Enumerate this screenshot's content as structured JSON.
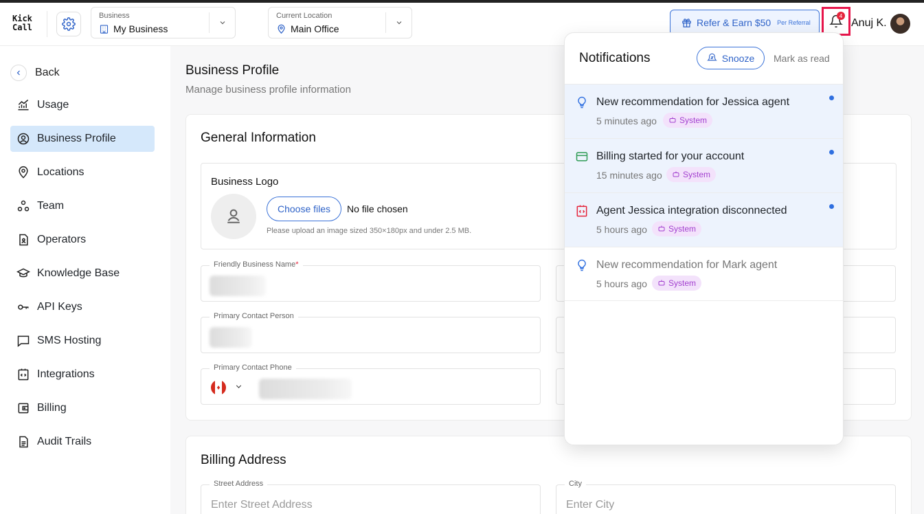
{
  "app": {
    "logo_line1": "Kick",
    "logo_line2": "Call"
  },
  "header": {
    "business_caption": "Business",
    "business_value": "My Business",
    "location_caption": "Current Location",
    "location_value": "Main Office",
    "refer_label": "Refer & Earn $50",
    "refer_sub": "Per Referral",
    "notification_count": "4",
    "user_name": "Anuj K."
  },
  "sidebar": {
    "back_label": "Back",
    "items": [
      {
        "label": "Usage",
        "icon": "chart-line-icon"
      },
      {
        "label": "Business Profile",
        "icon": "user-circle-icon",
        "active": true
      },
      {
        "label": "Locations",
        "icon": "map-pin-icon"
      },
      {
        "label": "Team",
        "icon": "team-icon"
      },
      {
        "label": "Operators",
        "icon": "operator-file-icon"
      },
      {
        "label": "Knowledge Base",
        "icon": "graduation-cap-icon"
      },
      {
        "label": "API Keys",
        "icon": "key-icon"
      },
      {
        "label": "SMS Hosting",
        "icon": "chat-bubble-icon"
      },
      {
        "label": "Integrations",
        "icon": "code-box-icon"
      },
      {
        "label": "Billing",
        "icon": "wallet-icon"
      },
      {
        "label": "Audit Trails",
        "icon": "document-icon"
      }
    ]
  },
  "main": {
    "title": "Business Profile",
    "subtitle": "Manage business profile information",
    "general": {
      "title": "General Information",
      "logo_label": "Business Logo",
      "choose_files": "Choose files",
      "no_file": "No file chosen",
      "hint": "Please upload an image sized 350×180px and under 2.5 MB.",
      "friendly_name_label": "Friendly Business Name",
      "required_mark": "*",
      "contact_person_label": "Primary Contact Person",
      "contact_phone_label": "Primary Contact Phone"
    },
    "billing": {
      "title": "Billing Address",
      "street_label": "Street Address",
      "street_placeholder": "Enter Street Address",
      "city_label": "City",
      "city_placeholder": "Enter City"
    }
  },
  "notifications": {
    "title": "Notifications",
    "snooze_label": "Snooze",
    "mark_read_label": "Mark as read",
    "items": [
      {
        "text": "New recommendation for Jessica agent",
        "time": "5 minutes ago",
        "tag": "System",
        "unread": true,
        "icon": "lightbulb-icon"
      },
      {
        "text": "Billing started for your account",
        "time": "15 minutes ago",
        "tag": "System",
        "unread": true,
        "icon": "credit-card-icon"
      },
      {
        "text": "Agent Jessica integration disconnected",
        "time": "5 hours ago",
        "tag": "System",
        "unread": true,
        "icon": "integration-alert-icon"
      },
      {
        "text": "New recommendation for Mark agent",
        "time": "5 hours ago",
        "tag": "System",
        "unread": false,
        "icon": "lightbulb-icon"
      }
    ]
  },
  "colors": {
    "accent": "#2f63c8",
    "active_nav": "#d5e8fb",
    "tag_bg": "#f3e2fb",
    "tag_text": "#a23fcf",
    "badge": "#e5243b"
  }
}
